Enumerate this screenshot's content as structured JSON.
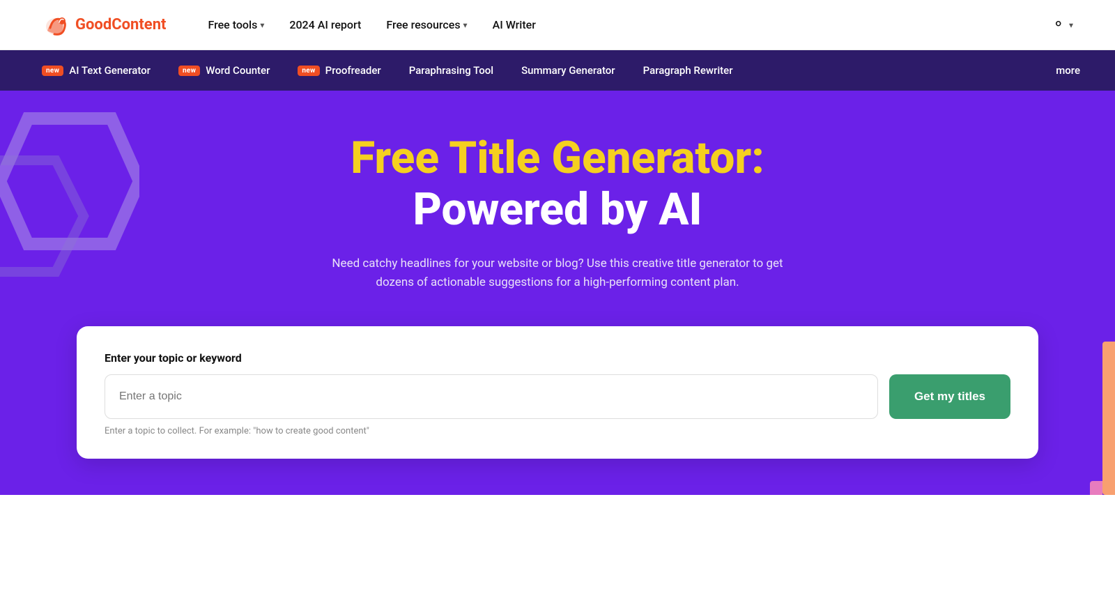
{
  "logo": {
    "name_bold": "Good",
    "name_accent": "Content"
  },
  "top_nav": {
    "items": [
      {
        "label": "Free tools",
        "has_chevron": true
      },
      {
        "label": "2024 AI report",
        "has_chevron": false
      },
      {
        "label": "Free resources",
        "has_chevron": true
      },
      {
        "label": "AI Writer",
        "has_chevron": false
      }
    ],
    "user_label": "Account",
    "user_chevron": true
  },
  "sub_nav": {
    "items": [
      {
        "label": "AI Text Generator",
        "is_new": true
      },
      {
        "label": "Word Counter",
        "is_new": true
      },
      {
        "label": "Proofreader",
        "is_new": true
      },
      {
        "label": "Paraphrasing Tool",
        "is_new": false
      },
      {
        "label": "Summary Generator",
        "is_new": false
      },
      {
        "label": "Paragraph Rewriter",
        "is_new": false
      }
    ],
    "more_label": "more"
  },
  "hero": {
    "title_yellow": "Free Title Generator:",
    "title_white": "Powered by AI",
    "subtitle": "Need catchy headlines for your website or blog? Use this creative title generator to get dozens of actionable suggestions for a high-performing content plan."
  },
  "tool_card": {
    "input_label": "Enter your topic or keyword",
    "input_placeholder": "Enter a topic",
    "hint": "Enter a topic to collect. For example: \"how to create good content\"",
    "button_label": "Get my titles"
  }
}
